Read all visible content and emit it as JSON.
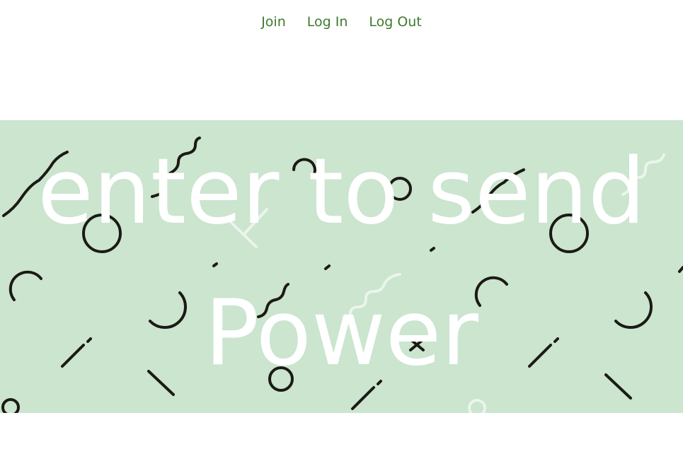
{
  "nav": {
    "items": [
      {
        "label": "Join"
      },
      {
        "label": "Log In"
      },
      {
        "label": "Log Out"
      }
    ]
  },
  "hero": {
    "line1": "enter to send",
    "line2": "Power",
    "background_color": "#cbe5cf",
    "text_color": "#ffffff",
    "shape_color": "#1c1a15"
  },
  "colors": {
    "link": "#3f7a2e"
  }
}
